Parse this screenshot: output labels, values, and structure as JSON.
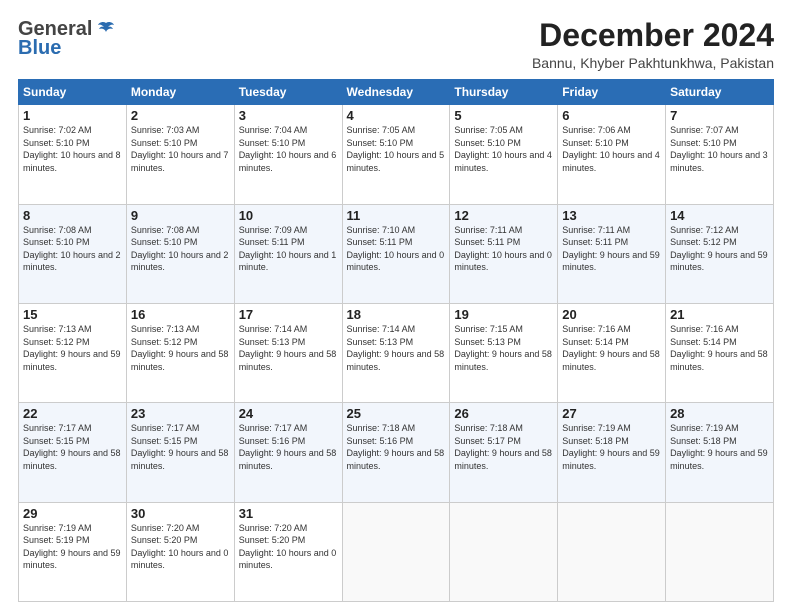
{
  "header": {
    "logo_general": "General",
    "logo_blue": "Blue",
    "month": "December 2024",
    "location": "Bannu, Khyber Pakhtunkhwa, Pakistan"
  },
  "weekdays": [
    "Sunday",
    "Monday",
    "Tuesday",
    "Wednesday",
    "Thursday",
    "Friday",
    "Saturday"
  ],
  "weeks": [
    [
      {
        "day": "1",
        "sunrise": "7:02 AM",
        "sunset": "5:10 PM",
        "daylight": "10 hours and 8 minutes."
      },
      {
        "day": "2",
        "sunrise": "7:03 AM",
        "sunset": "5:10 PM",
        "daylight": "10 hours and 7 minutes."
      },
      {
        "day": "3",
        "sunrise": "7:04 AM",
        "sunset": "5:10 PM",
        "daylight": "10 hours and 6 minutes."
      },
      {
        "day": "4",
        "sunrise": "7:05 AM",
        "sunset": "5:10 PM",
        "daylight": "10 hours and 5 minutes."
      },
      {
        "day": "5",
        "sunrise": "7:05 AM",
        "sunset": "5:10 PM",
        "daylight": "10 hours and 4 minutes."
      },
      {
        "day": "6",
        "sunrise": "7:06 AM",
        "sunset": "5:10 PM",
        "daylight": "10 hours and 4 minutes."
      },
      {
        "day": "7",
        "sunrise": "7:07 AM",
        "sunset": "5:10 PM",
        "daylight": "10 hours and 3 minutes."
      }
    ],
    [
      {
        "day": "8",
        "sunrise": "7:08 AM",
        "sunset": "5:10 PM",
        "daylight": "10 hours and 2 minutes."
      },
      {
        "day": "9",
        "sunrise": "7:08 AM",
        "sunset": "5:10 PM",
        "daylight": "10 hours and 2 minutes."
      },
      {
        "day": "10",
        "sunrise": "7:09 AM",
        "sunset": "5:11 PM",
        "daylight": "10 hours and 1 minute."
      },
      {
        "day": "11",
        "sunrise": "7:10 AM",
        "sunset": "5:11 PM",
        "daylight": "10 hours and 0 minutes."
      },
      {
        "day": "12",
        "sunrise": "7:11 AM",
        "sunset": "5:11 PM",
        "daylight": "10 hours and 0 minutes."
      },
      {
        "day": "13",
        "sunrise": "7:11 AM",
        "sunset": "5:11 PM",
        "daylight": "9 hours and 59 minutes."
      },
      {
        "day": "14",
        "sunrise": "7:12 AM",
        "sunset": "5:12 PM",
        "daylight": "9 hours and 59 minutes."
      }
    ],
    [
      {
        "day": "15",
        "sunrise": "7:13 AM",
        "sunset": "5:12 PM",
        "daylight": "9 hours and 59 minutes."
      },
      {
        "day": "16",
        "sunrise": "7:13 AM",
        "sunset": "5:12 PM",
        "daylight": "9 hours and 58 minutes."
      },
      {
        "day": "17",
        "sunrise": "7:14 AM",
        "sunset": "5:13 PM",
        "daylight": "9 hours and 58 minutes."
      },
      {
        "day": "18",
        "sunrise": "7:14 AM",
        "sunset": "5:13 PM",
        "daylight": "9 hours and 58 minutes."
      },
      {
        "day": "19",
        "sunrise": "7:15 AM",
        "sunset": "5:13 PM",
        "daylight": "9 hours and 58 minutes."
      },
      {
        "day": "20",
        "sunrise": "7:16 AM",
        "sunset": "5:14 PM",
        "daylight": "9 hours and 58 minutes."
      },
      {
        "day": "21",
        "sunrise": "7:16 AM",
        "sunset": "5:14 PM",
        "daylight": "9 hours and 58 minutes."
      }
    ],
    [
      {
        "day": "22",
        "sunrise": "7:17 AM",
        "sunset": "5:15 PM",
        "daylight": "9 hours and 58 minutes."
      },
      {
        "day": "23",
        "sunrise": "7:17 AM",
        "sunset": "5:15 PM",
        "daylight": "9 hours and 58 minutes."
      },
      {
        "day": "24",
        "sunrise": "7:17 AM",
        "sunset": "5:16 PM",
        "daylight": "9 hours and 58 minutes."
      },
      {
        "day": "25",
        "sunrise": "7:18 AM",
        "sunset": "5:16 PM",
        "daylight": "9 hours and 58 minutes."
      },
      {
        "day": "26",
        "sunrise": "7:18 AM",
        "sunset": "5:17 PM",
        "daylight": "9 hours and 58 minutes."
      },
      {
        "day": "27",
        "sunrise": "7:19 AM",
        "sunset": "5:18 PM",
        "daylight": "9 hours and 59 minutes."
      },
      {
        "day": "28",
        "sunrise": "7:19 AM",
        "sunset": "5:18 PM",
        "daylight": "9 hours and 59 minutes."
      }
    ],
    [
      {
        "day": "29",
        "sunrise": "7:19 AM",
        "sunset": "5:19 PM",
        "daylight": "9 hours and 59 minutes."
      },
      {
        "day": "30",
        "sunrise": "7:20 AM",
        "sunset": "5:20 PM",
        "daylight": "10 hours and 0 minutes."
      },
      {
        "day": "31",
        "sunrise": "7:20 AM",
        "sunset": "5:20 PM",
        "daylight": "10 hours and 0 minutes."
      },
      null,
      null,
      null,
      null
    ]
  ],
  "labels": {
    "sunrise": "Sunrise:",
    "sunset": "Sunset:",
    "daylight": "Daylight:"
  }
}
